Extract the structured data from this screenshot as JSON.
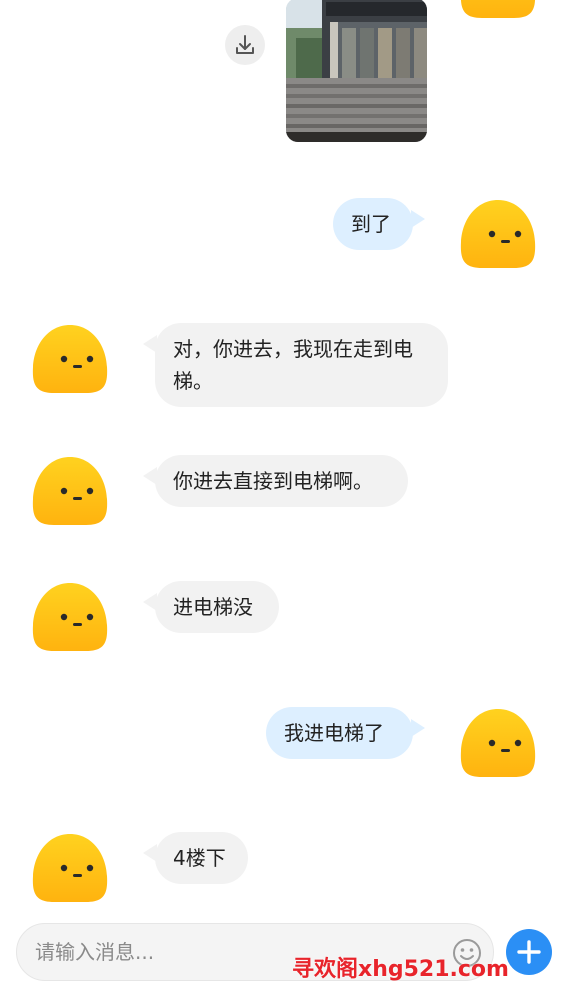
{
  "chat": {
    "messages": [
      {
        "direction": "out",
        "type": "image"
      },
      {
        "direction": "out",
        "type": "text",
        "text": "到了"
      },
      {
        "direction": "in",
        "type": "text",
        "line1": "对，你进去，我现在走到电",
        "line2": "梯。"
      },
      {
        "direction": "in",
        "type": "text",
        "text": "你进去直接到电梯啊。"
      },
      {
        "direction": "in",
        "type": "text",
        "text": "进电梯没"
      },
      {
        "direction": "out",
        "type": "text",
        "text": "我进电梯了"
      },
      {
        "direction": "in",
        "type": "text",
        "text": "4楼下"
      }
    ]
  },
  "composer": {
    "placeholder": "请输入消息..."
  },
  "icons": {
    "download": "download-icon",
    "emoji": "emoji-icon",
    "plus": "plus-icon",
    "avatar": "yellow-blob-avatar"
  },
  "colors": {
    "avatar_yellow": "#ffc21a",
    "bubble_in": "#f2f2f2",
    "bubble_out": "#ddefff",
    "accent": "#2b8ff5",
    "watermark": "#e8242b"
  },
  "watermark": {
    "text": "寻欢阁xhg521.com"
  }
}
